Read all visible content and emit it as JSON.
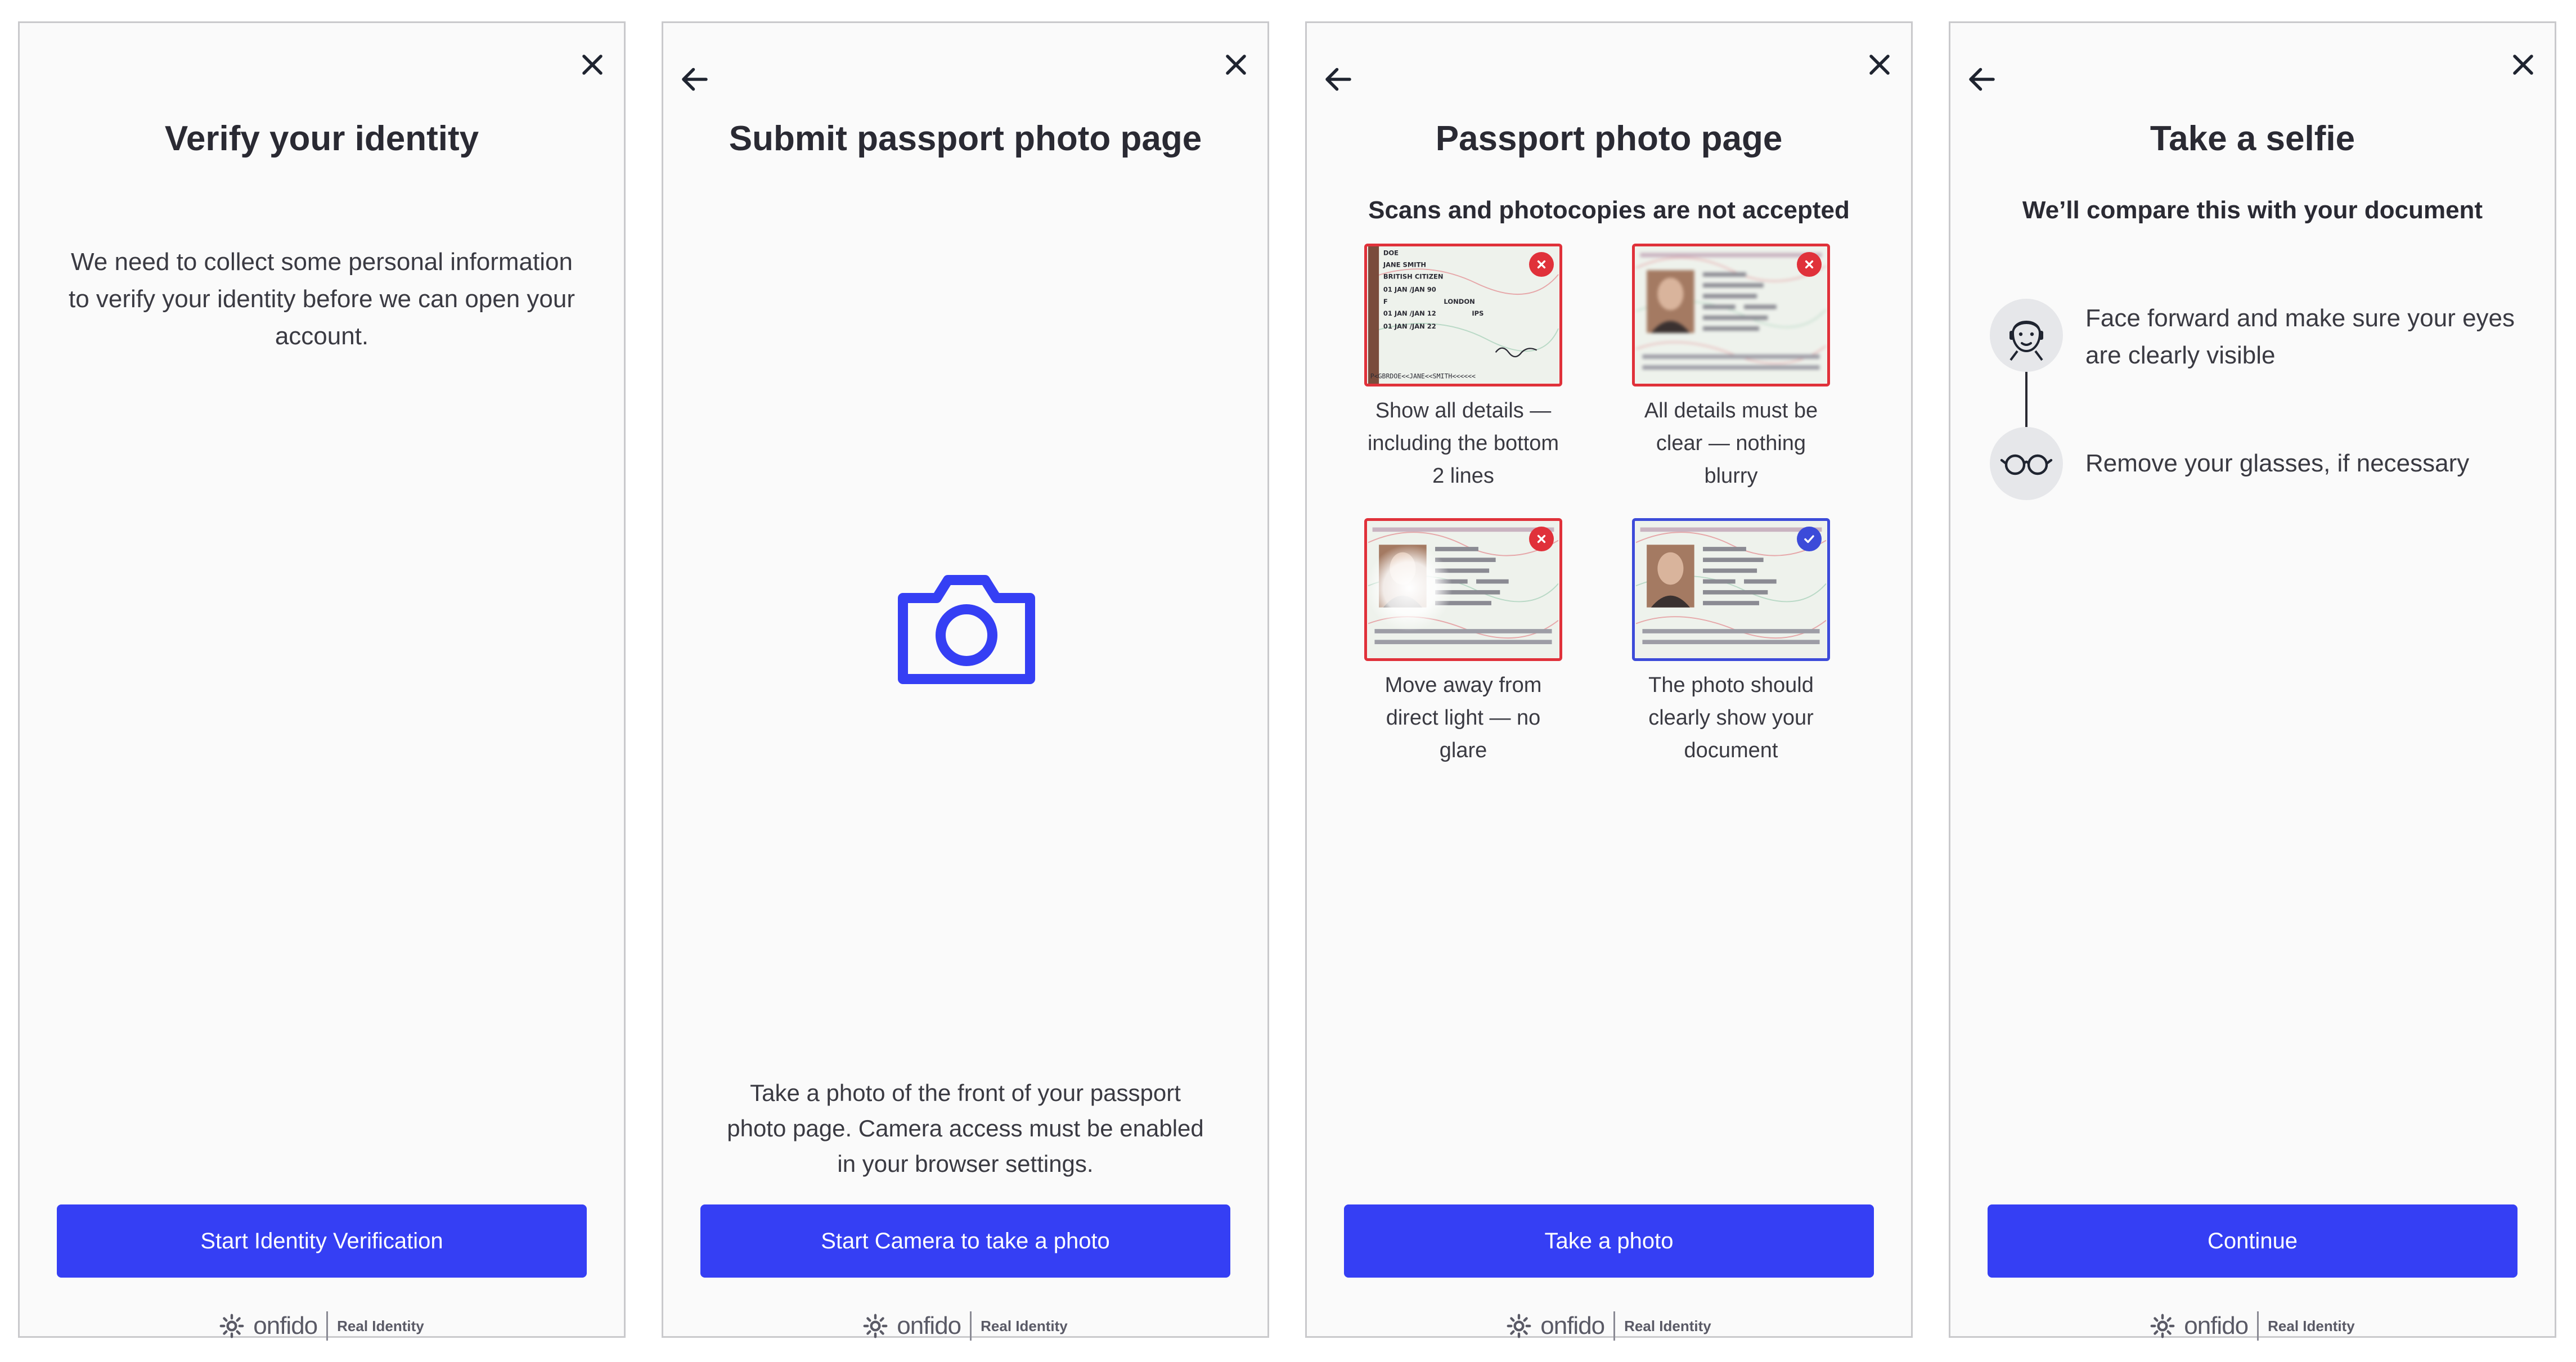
{
  "brand": {
    "name": "onfido",
    "tagline": "Real Identity",
    "accent_color": "#353ff4",
    "error_color": "#e0313a",
    "success_color": "#3c4bd9"
  },
  "screens": [
    {
      "title": "Verify your identity",
      "body": "We need to collect some personal information to verify your identity before we can open your account.",
      "button_label": "Start Identity Verification",
      "icons": [
        "close-icon"
      ]
    },
    {
      "title": "Submit passport photo page",
      "body": "Take a photo of the front of your passport photo page. Camera access must be enabled in your browser settings.",
      "button_label": "Start Camera to take a photo",
      "icons": [
        "back-arrow-icon",
        "close-icon",
        "camera-icon"
      ]
    },
    {
      "title": "Passport photo page",
      "subtitle": "Scans and photocopies are not accepted",
      "tiles": [
        {
          "caption": "Show all details — including the bottom 2 lines",
          "status": "error",
          "doc": {
            "surname": "DOE",
            "name": "JANE SMITH",
            "nationality": "BRITISH CITIZEN",
            "dob": "01  JAN  /JAN  90",
            "sex": "F",
            "place": "LONDON",
            "issued": "01  JAN  /JAN  12",
            "authority": "IPS",
            "expiry": "01  JAN  /JAN  22",
            "mrz": "P<GBRDOE<<JANE<<SMITH<<<<<<"
          }
        },
        {
          "caption": "All details must be clear — nothing blurry",
          "status": "error"
        },
        {
          "caption": "Move away from direct light — no glare",
          "status": "error"
        },
        {
          "caption": "The photo should clearly show your document",
          "status": "ok"
        }
      ],
      "button_label": "Take a photo",
      "icons": [
        "back-arrow-icon",
        "close-icon"
      ]
    },
    {
      "title": "Take a selfie",
      "subtitle": "We’ll compare this with your document",
      "steps": [
        {
          "text": "Face forward and make sure your eyes are clearly visible",
          "icon": "face-icon"
        },
        {
          "text": "Remove your glasses, if necessary",
          "icon": "glasses-icon"
        }
      ],
      "button_label": "Continue",
      "icons": [
        "back-arrow-icon",
        "close-icon"
      ]
    }
  ]
}
